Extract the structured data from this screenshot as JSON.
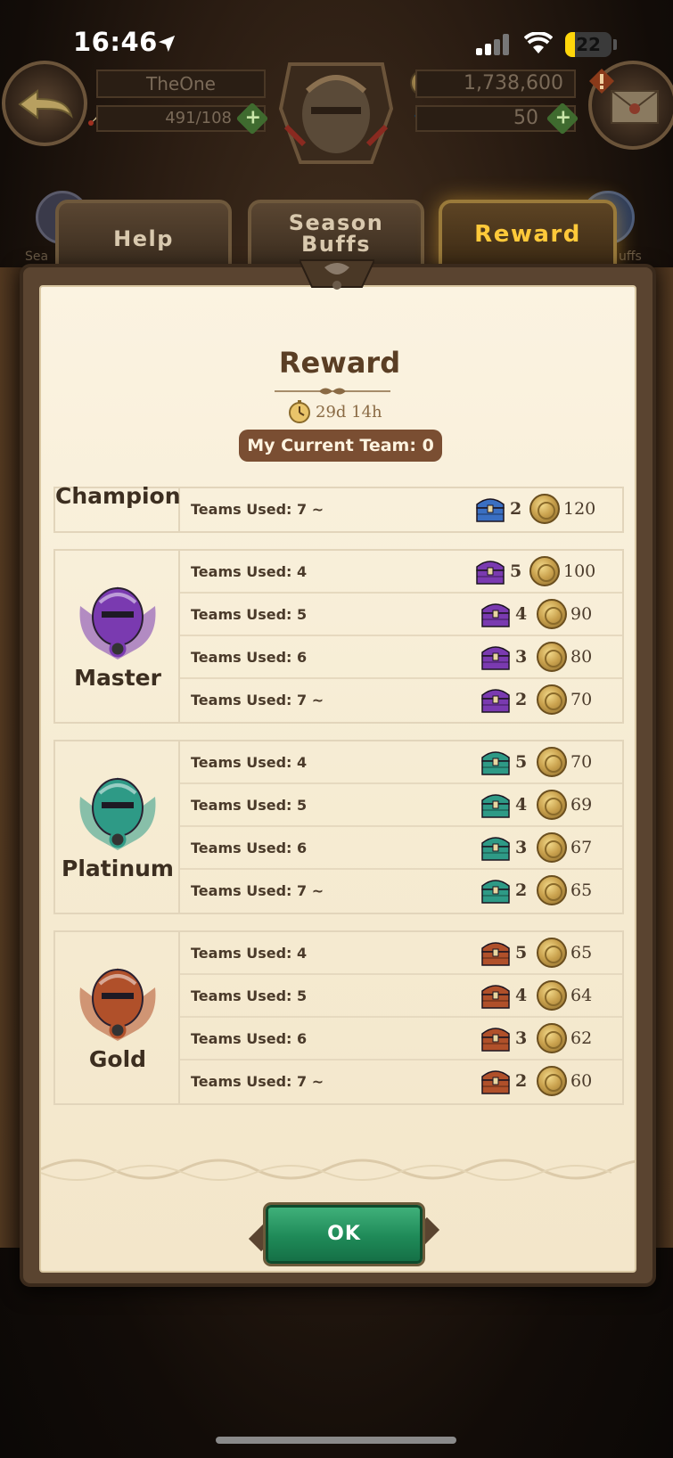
{
  "status_bar": {
    "time": "16:46",
    "battery": "22",
    "battery_level": 0.22
  },
  "header": {
    "player_name": "TheOne",
    "energy": "491/108",
    "gold": "1,738,600",
    "gems": "50"
  },
  "tabs": [
    {
      "label": "Help"
    },
    {
      "label": "Season Buffs"
    },
    {
      "label": "Reward"
    }
  ],
  "active_tab": "Reward",
  "side_labels": {
    "left": "Sea",
    "right": "uffs"
  },
  "dialog": {
    "title": "Reward",
    "timer": "29d 14h",
    "current_team": "My Current Team: 0",
    "ok_label": "OK"
  },
  "tiers": [
    {
      "name": "Champion",
      "chest_color": "#3a6fc2",
      "rows": [
        {
          "label": "Teams Used: 7 ~",
          "chests": "2",
          "gold": "120"
        }
      ]
    },
    {
      "name": "Master",
      "chest_color": "#7a3ab0",
      "rows": [
        {
          "label": "Teams Used: 4",
          "chests": "5",
          "gold": "100"
        },
        {
          "label": "Teams Used: 5",
          "chests": "4",
          "gold": "90"
        },
        {
          "label": "Teams Used: 6",
          "chests": "3",
          "gold": "80"
        },
        {
          "label": "Teams Used: 7 ~",
          "chests": "2",
          "gold": "70"
        }
      ]
    },
    {
      "name": "Platinum",
      "chest_color": "#2e9a86",
      "rows": [
        {
          "label": "Teams Used: 4",
          "chests": "5",
          "gold": "70"
        },
        {
          "label": "Teams Used: 5",
          "chests": "4",
          "gold": "69"
        },
        {
          "label": "Teams Used: 6",
          "chests": "3",
          "gold": "67"
        },
        {
          "label": "Teams Used: 7 ~",
          "chests": "2",
          "gold": "65"
        }
      ]
    },
    {
      "name": "Gold",
      "chest_color": "#b0502a",
      "rows": [
        {
          "label": "Teams Used: 4",
          "chests": "5",
          "gold": "65"
        },
        {
          "label": "Teams Used: 5",
          "chests": "4",
          "gold": "64"
        },
        {
          "label": "Teams Used: 6",
          "chests": "3",
          "gold": "62"
        },
        {
          "label": "Teams Used: 7 ~",
          "chests": "2",
          "gold": "60"
        }
      ]
    }
  ]
}
